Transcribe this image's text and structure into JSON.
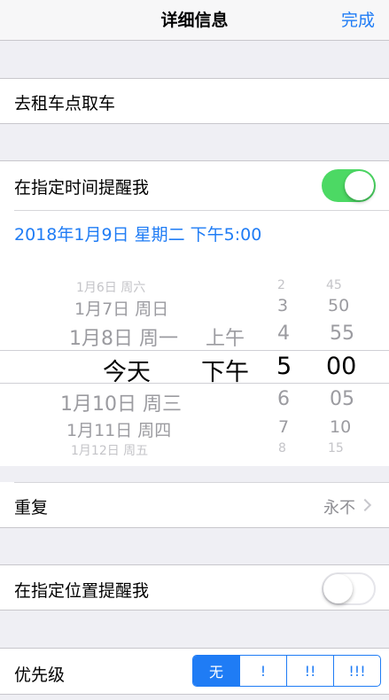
{
  "navbar": {
    "title": "详细信息",
    "done_label": "完成"
  },
  "task": {
    "title": "去租车点取车"
  },
  "remind_time": {
    "label": "在指定时间提醒我",
    "enabled": true,
    "datetime": "2018年1月9日 星期二 下午5:00"
  },
  "picker": {
    "dates": [
      "1月6日 周六",
      "1月7日 周日",
      "1月8日 周一",
      "今天",
      "1月10日 周三",
      "1月11日 周四",
      "1月12日 周五"
    ],
    "ampm": [
      "上午",
      "下午"
    ],
    "hours": [
      "2",
      "3",
      "4",
      "5",
      "6",
      "7",
      "8"
    ],
    "minutes": [
      "45",
      "50",
      "55",
      "00",
      "05",
      "10",
      "15"
    ]
  },
  "repeat": {
    "label": "重复",
    "value": "永不"
  },
  "remind_location": {
    "label": "在指定位置提醒我",
    "enabled": false
  },
  "priority": {
    "label": "优先级",
    "options": [
      "无",
      "!",
      "!!",
      "!!!"
    ],
    "selected": "无"
  },
  "colors": {
    "accent": "#1f7cf5",
    "switch_on": "#4cd964"
  }
}
